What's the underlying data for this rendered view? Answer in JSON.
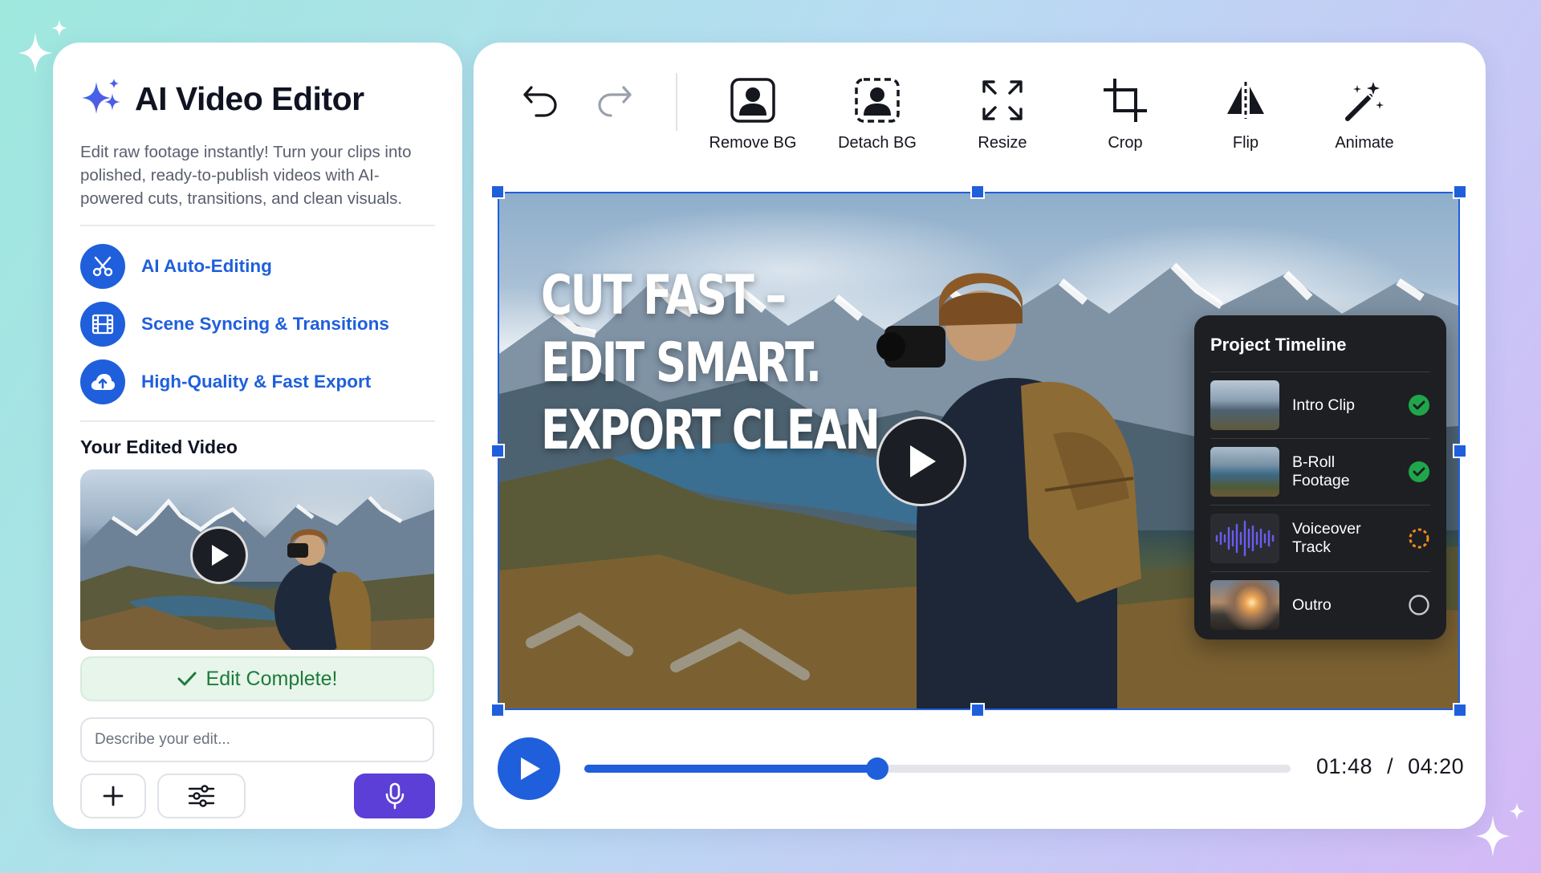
{
  "app": {
    "title": "AI Video Editor",
    "description": "Edit raw footage instantly! Turn your clips into polished, ready-to-publish videos with AI-powered cuts, transitions, and clean visuals."
  },
  "features": [
    {
      "label": "AI Auto-Editing",
      "icon": "scissors-icon"
    },
    {
      "label": "Scene Syncing & Transitions",
      "icon": "film-icon"
    },
    {
      "label": "High-Quality & Fast Export",
      "icon": "cloud-upload-icon"
    }
  ],
  "preview": {
    "section_title": "Your Edited Video",
    "complete_label": "Edit Complete!",
    "input_placeholder": "Describe your edit..."
  },
  "toolbar": {
    "tools": [
      {
        "label": "Remove BG",
        "icon": "person-frame-icon"
      },
      {
        "label": "Detach BG",
        "icon": "person-dashed-frame-icon"
      },
      {
        "label": "Resize",
        "icon": "resize-arrows-icon"
      },
      {
        "label": "Crop",
        "icon": "crop-icon"
      },
      {
        "label": "Flip",
        "icon": "flip-icon"
      },
      {
        "label": "Animate",
        "icon": "magic-wand-icon"
      }
    ]
  },
  "video": {
    "headline": [
      "CUT FAST –",
      "EDIT SMART.",
      "EXPORT CLEAN."
    ]
  },
  "timeline": {
    "title": "Project Timeline",
    "items": [
      {
        "name": "Intro Clip",
        "status": "complete"
      },
      {
        "name": "B-Roll Footage",
        "status": "complete"
      },
      {
        "name": "Voiceover Track",
        "status": "in-progress"
      },
      {
        "name": "Outro",
        "status": "pending"
      }
    ]
  },
  "playback": {
    "current": "01:48",
    "separator": "/",
    "total": "04:20",
    "progress": 0.415
  },
  "colors": {
    "accent": "#1f5fdc",
    "success": "#1fa64a",
    "progress_ring": "#f08a1c",
    "mic_button": "#5b3fd6"
  }
}
